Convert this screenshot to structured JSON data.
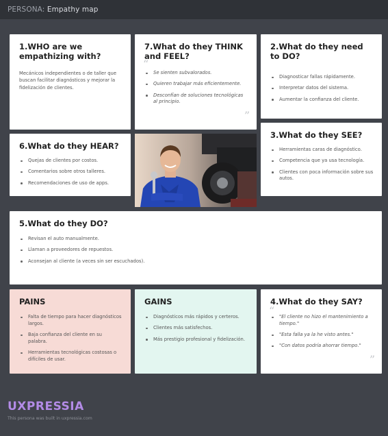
{
  "header": {
    "prefix": "PERSONA:",
    "title": "Empathy map"
  },
  "who": {
    "title": "1.WHO are we empathizing with?",
    "text": "Mecánicos independientes o de taller que buscan facilitar diagnósticos y mejorar la fidelización de clientes."
  },
  "think": {
    "title": "7.What do they THINK and FEEL?",
    "items": [
      "Se sienten subvalorados.",
      "Quieren trabajar más eficientemente.",
      "Desconfían de soluciones tecnológicas al principio."
    ]
  },
  "need": {
    "title": "2.What do they need to DO?",
    "items": [
      "Diagnosticar fallas rápidamente.",
      "Interpretar datos del sistema.",
      "Aumentar la confianza del cliente."
    ]
  },
  "hear": {
    "title": "6.What do they HEAR?",
    "items": [
      "Quejas de clientes por costos.",
      "Comentarios sobre otros talleres.",
      "Recomendaciones de uso de apps."
    ]
  },
  "see": {
    "title": "3.What do they SEE?",
    "items": [
      "Herramientas caras de diagnóstico.",
      "Competencia que ya usa tecnología.",
      "Clientes con poca información sobre sus autos."
    ]
  },
  "do": {
    "title": "5.What do they DO?",
    "items": [
      "Revisan el auto manualmente.",
      "Llaman a proveedores de repuestos.",
      "Aconsejan al cliente (a veces sin ser escuchados)."
    ]
  },
  "pains": {
    "title": "PAINS",
    "items": [
      "Falta de tiempo para hacer diagnósticos largos.",
      "Baja confianza del cliente en su palabra.",
      "Herramientas tecnológicas costosas o difíciles de usar."
    ]
  },
  "gains": {
    "title": "GAINS",
    "items": [
      "Diagnósticos más rápidos y certeros.",
      "Clientes más satisfechos.",
      "Más prestigio profesional y fidelización."
    ]
  },
  "say": {
    "title": "4.What do they SAY?",
    "items": [
      "\"El cliente no hizo el mantenimiento a tiempo.\"",
      "\"Esta falla ya la he visto antes.\"",
      "\"Con datos podría ahorrar tiempo.\""
    ]
  },
  "footer": {
    "brand": "UXPRESSIA",
    "note": "This persona was built in uxpressia.com"
  },
  "icons": {
    "quote": "quote-icon"
  },
  "colors": {
    "pains_bg": "#f7dbd6",
    "gains_bg": "#e3f6f0",
    "brand": "#b38be6"
  }
}
